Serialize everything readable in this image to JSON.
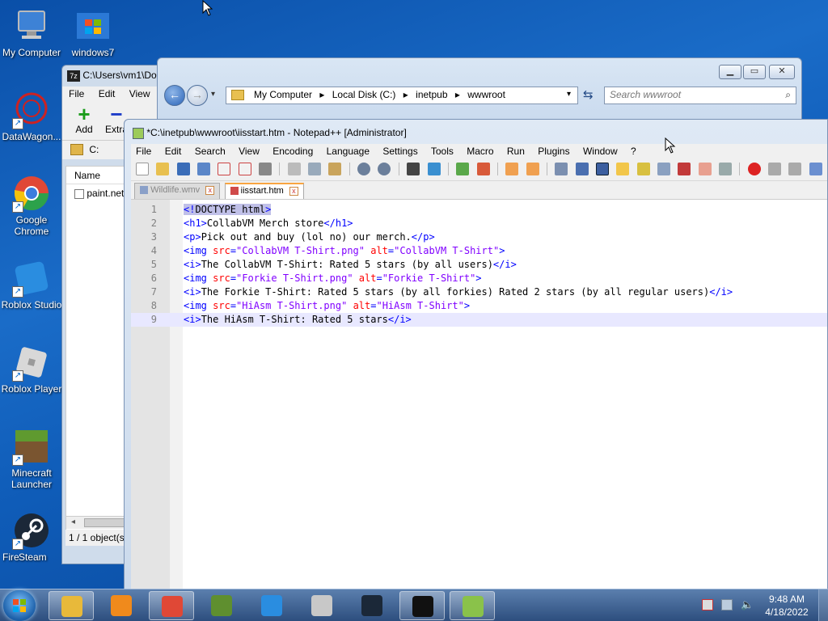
{
  "desktop": {
    "icons": [
      {
        "label": "My Computer"
      },
      {
        "label": "windows7"
      },
      {
        "label": "DataWagon..."
      },
      {
        "label": "Google Chrome"
      },
      {
        "label": "Roblox Studio"
      },
      {
        "label": "Roblox Player"
      },
      {
        "label": "Minecraft Launcher"
      },
      {
        "label": "Steam"
      },
      {
        "label": "Fire"
      }
    ]
  },
  "sevenzip": {
    "title": "C:\\Users\\vm1\\Do",
    "menu": [
      "File",
      "Edit",
      "View"
    ],
    "toolbar": {
      "add": "Add",
      "extract": "Extra"
    },
    "path": "C:",
    "column_name": "Name",
    "file": "paint.net",
    "status": "1 / 1 object(s"
  },
  "explorer": {
    "breadcrumb": [
      "My Computer",
      "Local Disk (C:)",
      "inetpub",
      "wwwroot"
    ],
    "search_placeholder": "Search wwwroot"
  },
  "notepadpp": {
    "title": "*C:\\inetpub\\wwwroot\\iisstart.htm - Notepad++ [Administrator]",
    "menu": [
      "File",
      "Edit",
      "Search",
      "View",
      "Encoding",
      "Language",
      "Settings",
      "Tools",
      "Macro",
      "Run",
      "Plugins",
      "Window",
      "?"
    ],
    "tabs": [
      {
        "label": "Wildlife.wmv",
        "active": false
      },
      {
        "label": "iisstart.htm",
        "active": true
      }
    ],
    "lines": [
      {
        "n": "1",
        "parts": [
          [
            "tag sel",
            "<!"
          ],
          [
            "txt sel",
            "DOCTYPE html"
          ],
          [
            "tag sel",
            ">"
          ]
        ]
      },
      {
        "n": "2",
        "parts": [
          [
            "tag",
            "<h1>"
          ],
          [
            "txt",
            "CollabVM Merch store"
          ],
          [
            "tag",
            "</h1>"
          ]
        ]
      },
      {
        "n": "3",
        "parts": [
          [
            "tag",
            "<p>"
          ],
          [
            "txt",
            "Pick out and buy (lol no) our merch."
          ],
          [
            "tag",
            "</p>"
          ]
        ]
      },
      {
        "n": "4",
        "parts": [
          [
            "tag",
            "<img "
          ],
          [
            "attr",
            "src"
          ],
          [
            "tag",
            "="
          ],
          [
            "val",
            "\"CollabVM T-Shirt.png\""
          ],
          [
            "tag",
            " "
          ],
          [
            "attr",
            "alt"
          ],
          [
            "tag",
            "="
          ],
          [
            "val",
            "\"CollabVM T-Shirt\""
          ],
          [
            "tag",
            ">"
          ]
        ]
      },
      {
        "n": "5",
        "parts": [
          [
            "tag",
            "<i>"
          ],
          [
            "txt",
            "The CollabVM T-Shirt: Rated 5 stars (by all users)"
          ],
          [
            "tag",
            "</i>"
          ]
        ]
      },
      {
        "n": "6",
        "parts": [
          [
            "tag",
            "<img "
          ],
          [
            "attr",
            "src"
          ],
          [
            "tag",
            "="
          ],
          [
            "val",
            "\"Forkie T-Shirt.png\""
          ],
          [
            "tag",
            " "
          ],
          [
            "attr",
            "alt"
          ],
          [
            "tag",
            "="
          ],
          [
            "val",
            "\"Forkie T-Shirt\""
          ],
          [
            "tag",
            ">"
          ]
        ]
      },
      {
        "n": "7",
        "parts": [
          [
            "tag",
            "<i>"
          ],
          [
            "txt",
            "The Forkie T-Shirt: Rated 5 stars (by all forkies) Rated 2 stars (by all regular users)"
          ],
          [
            "tag",
            "</i>"
          ]
        ]
      },
      {
        "n": "8",
        "parts": [
          [
            "tag",
            "<img "
          ],
          [
            "attr",
            "src"
          ],
          [
            "tag",
            "="
          ],
          [
            "val",
            "\"HiAsm T-Shirt.png\""
          ],
          [
            "tag",
            " "
          ],
          [
            "attr",
            "alt"
          ],
          [
            "tag",
            "="
          ],
          [
            "val",
            "\"HiAsm T-Shirt\""
          ],
          [
            "tag",
            ">"
          ]
        ]
      },
      {
        "n": "9",
        "parts": [
          [
            "tag",
            "<i>"
          ],
          [
            "txt",
            "The HiAsm T-Shirt: Rated 5 stars"
          ],
          [
            "tag",
            "</i>"
          ]
        ]
      }
    ],
    "current_line": 9
  },
  "taskbar": {
    "apps": [
      {
        "name": "explorer-icon",
        "color": "#e8b93a",
        "open": true
      },
      {
        "name": "media-player-icon",
        "color": "#f08a1c",
        "open": false
      },
      {
        "name": "chrome-icon",
        "color": "#e04836",
        "open": true
      },
      {
        "name": "minecraft-icon",
        "color": "#5f8f2f",
        "open": false
      },
      {
        "name": "roblox-studio-icon",
        "color": "#2a8de0",
        "open": false
      },
      {
        "name": "roblox-player-icon",
        "color": "#c8c8c8",
        "open": false
      },
      {
        "name": "steam-icon",
        "color": "#1b2838",
        "open": false
      },
      {
        "name": "7zip-icon",
        "color": "#111111",
        "open": true
      },
      {
        "name": "notepadpp-icon",
        "color": "#8ac24a",
        "open": true
      }
    ],
    "time": "9:48 AM",
    "date": "4/18/2022"
  }
}
